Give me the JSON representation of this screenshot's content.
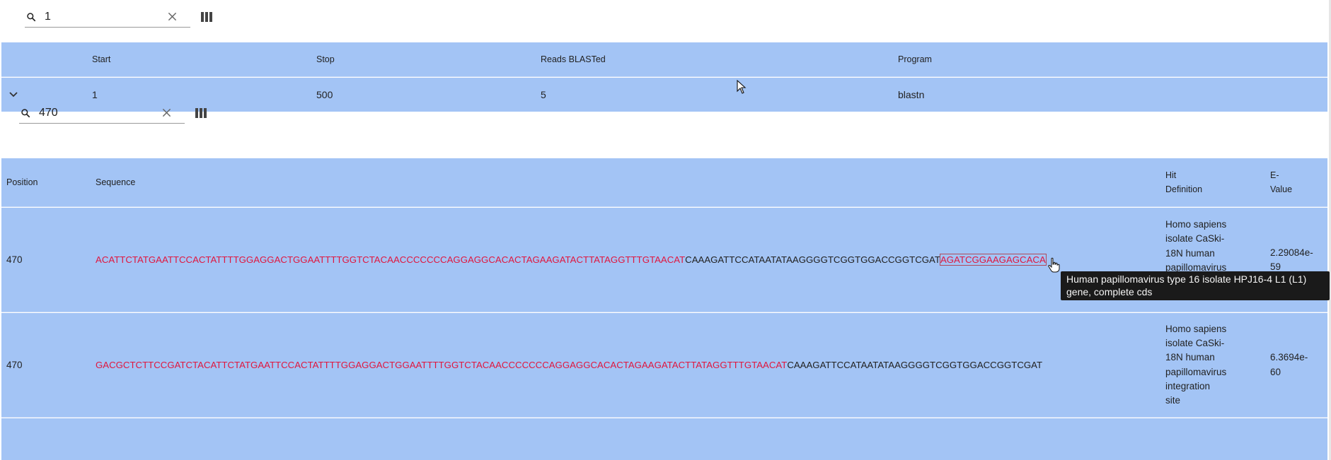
{
  "outer_search": {
    "value": "1",
    "icons": {
      "search": "search-icon",
      "clear": "close-icon",
      "columns": "view-columns-icon"
    }
  },
  "outer_table": {
    "headers": {
      "start": "Start",
      "stop": "Stop",
      "reads": "Reads BLASTed",
      "program": "Program"
    },
    "row": {
      "start": "1",
      "stop": "500",
      "reads": "5",
      "program": "blastn"
    },
    "expand_icon": "chevron-down-icon"
  },
  "inner_search": {
    "value": "470",
    "icons": {
      "search": "search-icon",
      "clear": "close-icon",
      "columns": "view-columns-icon"
    }
  },
  "inner_table": {
    "headers": {
      "position": "Position",
      "sequence": "Sequence",
      "hit_definition_line1": "Hit",
      "hit_definition_line2": "Definition",
      "evalue_line1": "E-",
      "evalue_line2": "Value"
    },
    "rows": [
      {
        "position": "470",
        "seq_hit": "ACATTCTATGAATTCCACTATTTTGGAGGACTGGAATTTTGGTCTACAACCCCCCCAGGAGGCACACTAGAAGATACTTATAGGTTTGTAACAT",
        "seq_plain": "CAAAGATTCCATAATATAAGGGGTCGGTGGACCGGTCGAT",
        "seq_boxed": "AGATCGGAAGAGCACA",
        "hit_lines": [
          "Homo sapiens",
          "isolate CaSki-",
          "18N human",
          "papillomavirus"
        ],
        "evalue_lines": [
          "2.29084e-",
          "59"
        ]
      },
      {
        "position": "470",
        "seq_hit": "GACGCTCTTCCGATCTACATTCTATGAATTCCACTATTTTGGAGGACTGGAATTTTGGTCTACAACCCCCCCAGGAGGCACACTAGAAGATACTTATAGGTTTGTAACAT",
        "seq_plain": "CAAAGATTCCATAATATAAGGGGTCGGTGGACCGGTCGAT",
        "hit_lines": [
          "Homo sapiens",
          "isolate CaSki-",
          "18N human",
          "papillomavirus",
          "integration",
          "site"
        ],
        "evalue_lines": [
          "6.3694e-",
          "60"
        ]
      }
    ]
  },
  "tooltip": {
    "line1": "Human papillomavirus type 16 isolate HPJ16-4 L1 (L1)",
    "line2": "gene, complete cds"
  },
  "colors": {
    "header_bg": "#a3c4f5",
    "row_bg": "#a3c4f5",
    "hit_sequence": "#e0163e",
    "tooltip_bg": "#1a1a1a"
  }
}
